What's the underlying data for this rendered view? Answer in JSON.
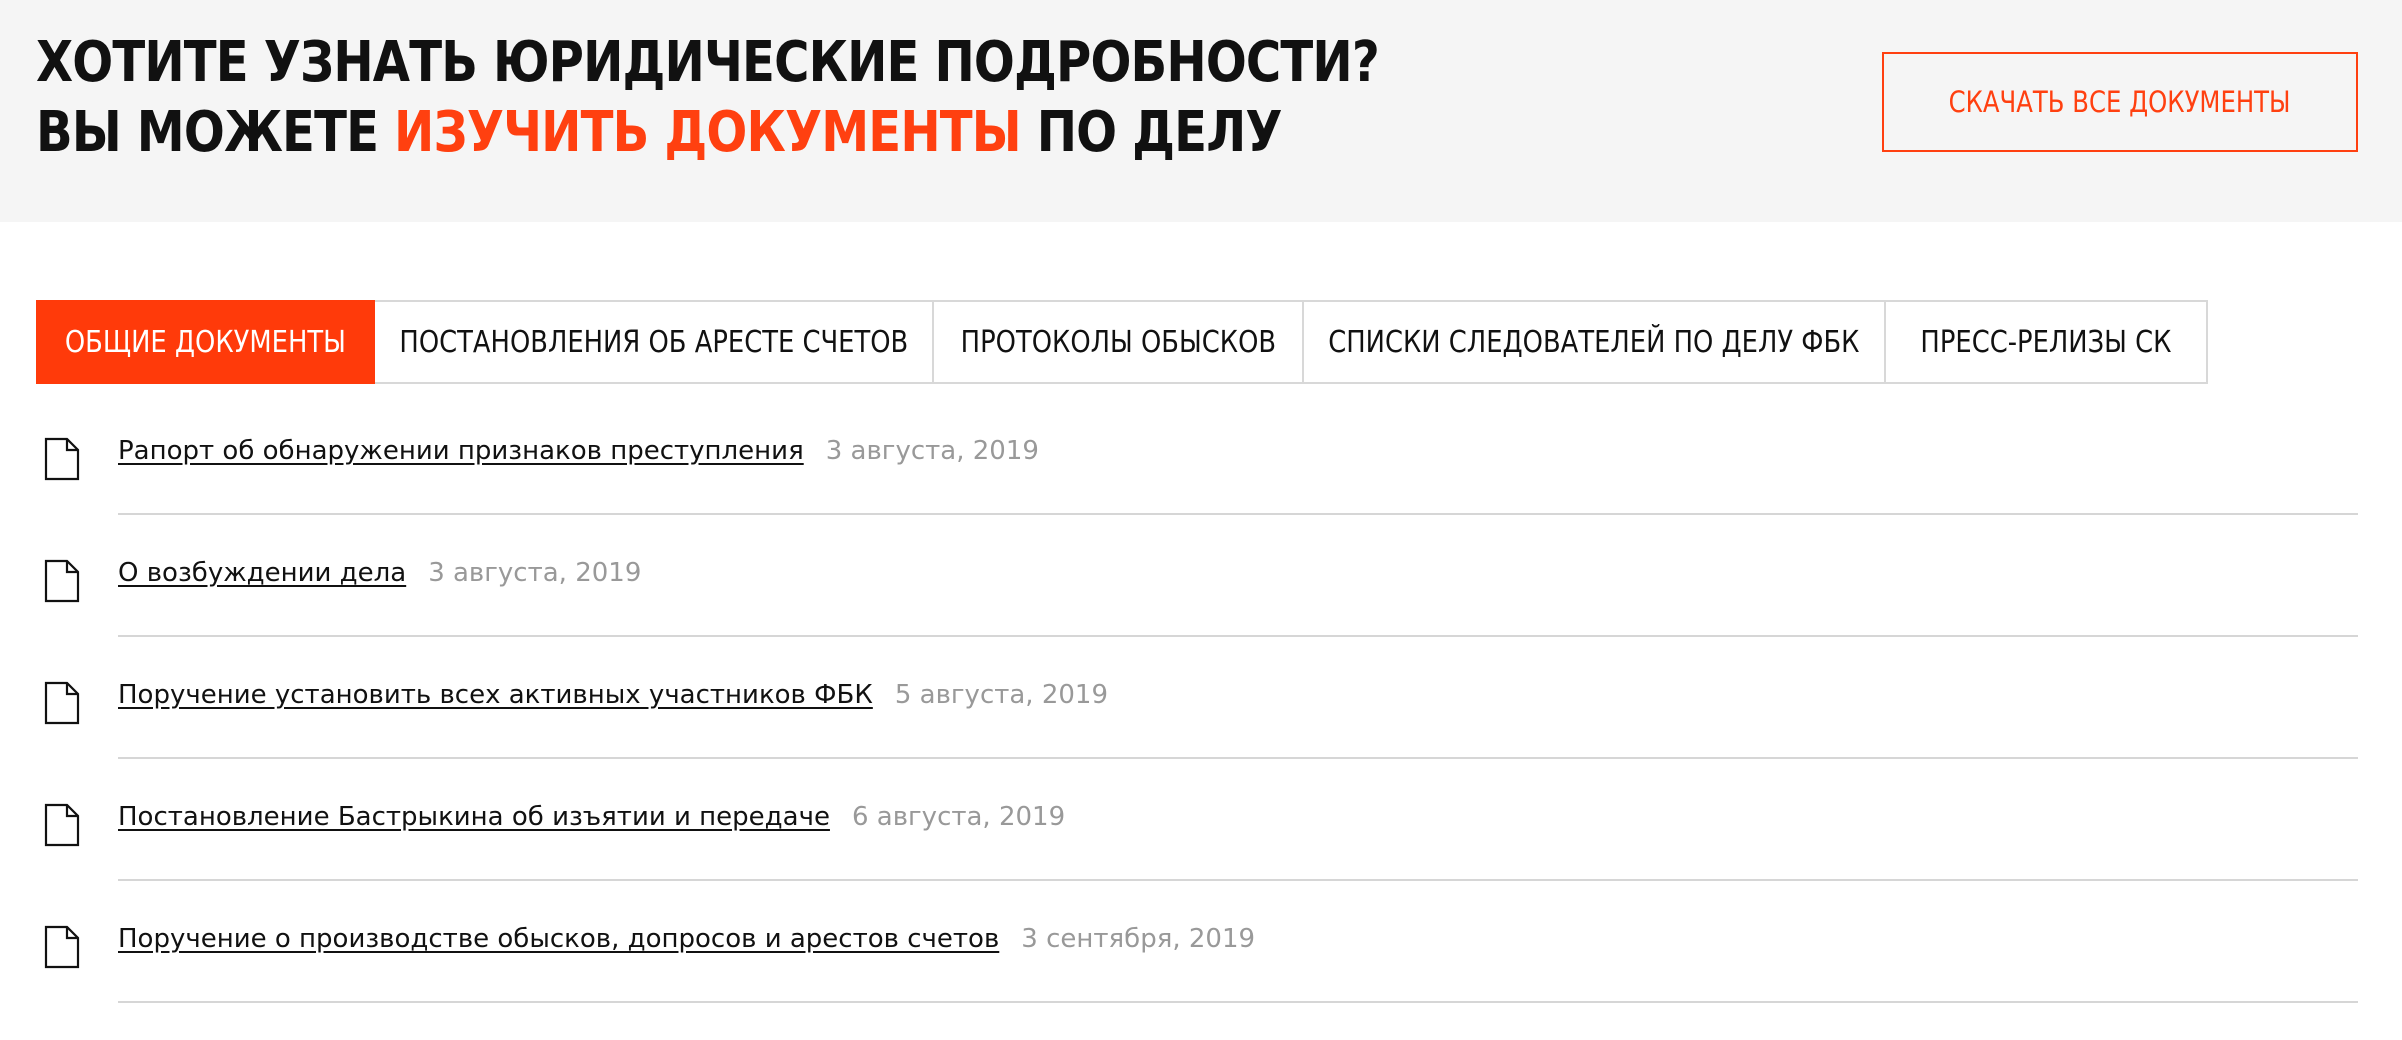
{
  "header": {
    "line1": "ХОТИТЕ УЗНАТЬ ЮРИДИЧЕСКИЕ ПОДРОБНОСТИ?",
    "line2_before": "ВЫ МОЖЕТЕ ",
    "line2_accent": "ИЗУЧИТЬ ДОКУМЕНТЫ",
    "line2_after": " ПО ДЕЛУ",
    "download_label": "СКАЧАТЬ ВСЕ ДОКУМЕНТЫ"
  },
  "tabs": [
    {
      "label": "ОБЩИЕ ДОКУМЕНТЫ",
      "active": true
    },
    {
      "label": "ПОСТАНОВЛЕНИЯ ОБ АРЕСТЕ СЧЕТОВ",
      "active": false
    },
    {
      "label": "ПРОТОКОЛЫ ОБЫСКОВ",
      "active": false
    },
    {
      "label": "СПИСКИ СЛЕДОВАТЕЛЕЙ ПО ДЕЛУ ФБК",
      "active": false
    },
    {
      "label": "ПРЕСС-РЕЛИЗЫ СК",
      "active": false
    }
  ],
  "documents": [
    {
      "title": "Рапорт об обнаружении признаков преступления",
      "date": "3 августа, 2019",
      "icon": "document-icon"
    },
    {
      "title": "О возбуждении дела",
      "date": "3 августа, 2019",
      "icon": "document-icon"
    },
    {
      "title": "Поручение установить всех активных участников ФБК",
      "date": "5 августа, 2019",
      "icon": "document-icon"
    },
    {
      "title": "Постановление Бастрыкина об изъятии и передаче",
      "date": "6 августа, 2019",
      "icon": "document-icon"
    },
    {
      "title": "Поручение о производстве обысков, допросов и арестов счетов",
      "date": "3 сентября, 2019",
      "icon": "document-icon"
    }
  ],
  "colors": {
    "accent": "#ff4010",
    "active_tab": "#ff3a0a",
    "header_bg": "#f5f5f5",
    "date_text": "#999999",
    "divider": "#d6d6d6"
  }
}
